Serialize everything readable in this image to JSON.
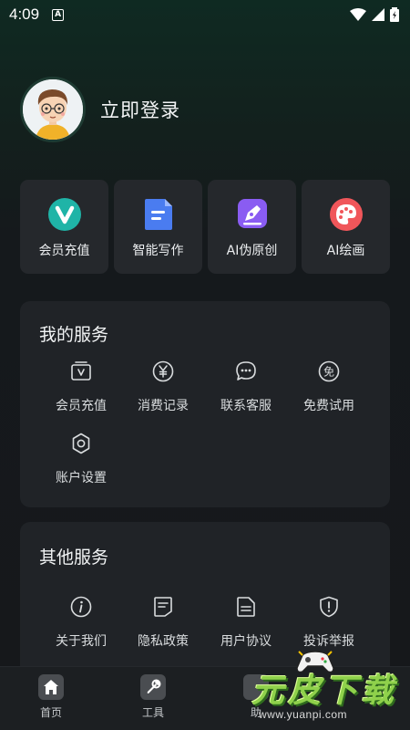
{
  "status_bar": {
    "time": "4:09",
    "notification_letter": "A"
  },
  "profile": {
    "login_label": "立即登录"
  },
  "quick_actions": [
    {
      "label": "会员充值",
      "icon": "vip-v-icon",
      "color": "#1fb4a7"
    },
    {
      "label": "智能写作",
      "icon": "document-icon",
      "color": "#4a7cf0"
    },
    {
      "label": "AI伪原创",
      "icon": "pen-icon",
      "color": "#8a5cf2"
    },
    {
      "label": "AI绘画",
      "icon": "palette-icon",
      "color": "#f0565a"
    }
  ],
  "my_services": {
    "title": "我的服务",
    "items": [
      {
        "label": "会员充值",
        "icon": "vip-card-icon"
      },
      {
        "label": "消费记录",
        "icon": "yuan-icon"
      },
      {
        "label": "联系客服",
        "icon": "chat-icon"
      },
      {
        "label": "免费试用",
        "icon": "free-icon"
      },
      {
        "label": "账户设置",
        "icon": "gear-icon"
      }
    ]
  },
  "other_services": {
    "title": "其他服务",
    "items": [
      {
        "label": "关于我们",
        "icon": "info-icon"
      },
      {
        "label": "隐私政策",
        "icon": "privacy-doc-icon"
      },
      {
        "label": "用户协议",
        "icon": "agreement-icon"
      },
      {
        "label": "投诉举报",
        "icon": "report-shield-icon"
      }
    ]
  },
  "bottom_nav": [
    {
      "label": "首页",
      "icon": "home-icon"
    },
    {
      "label": "工具",
      "icon": "wrench-icon"
    },
    {
      "label": "助",
      "icon": "assistant-icon"
    }
  ],
  "watermark": {
    "text": "元皮下载",
    "url": "www.yuanpi.com"
  }
}
